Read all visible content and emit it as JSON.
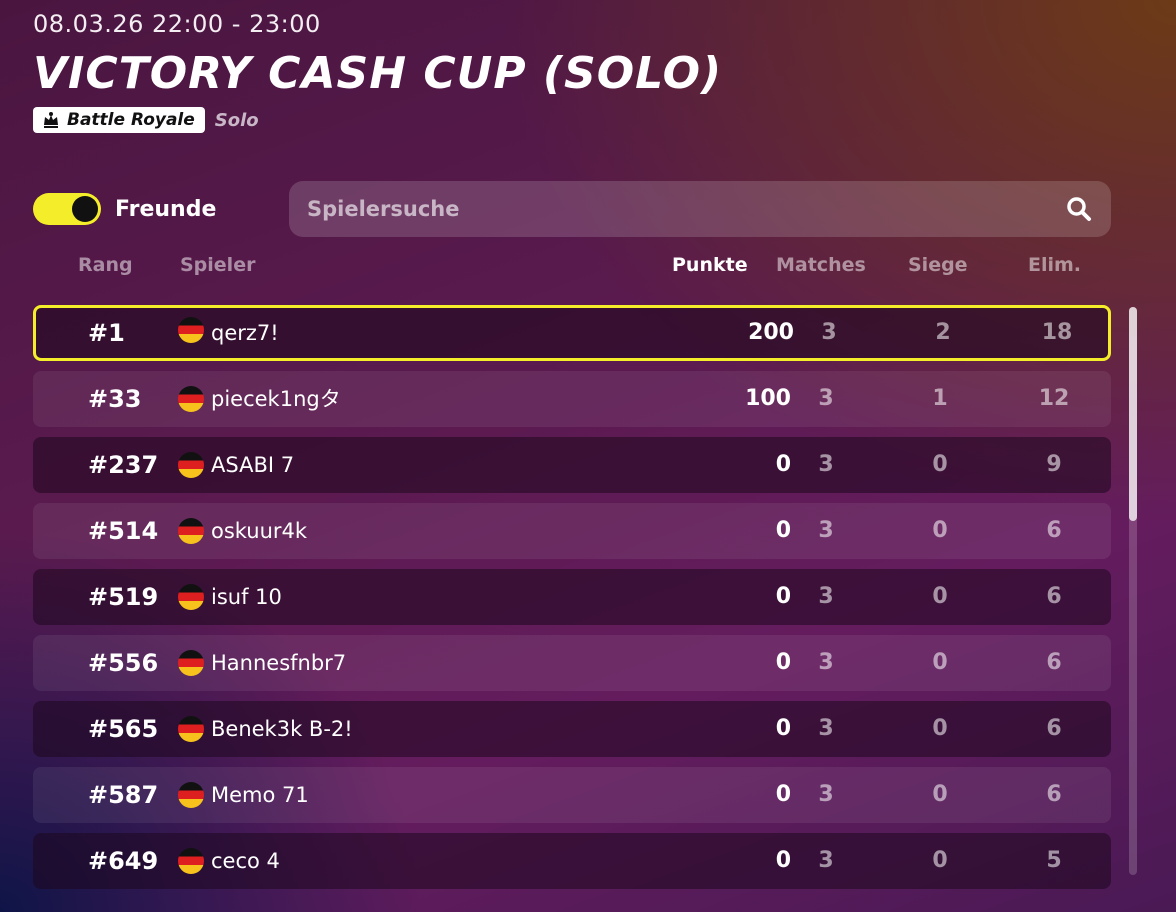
{
  "event": {
    "datetime": "08.03.26 22:00 - 23:00",
    "title": "VICTORY CASH CUP (SOLO)",
    "mode_badge": "Battle Royale",
    "type": "Solo"
  },
  "filters": {
    "friends_toggle_label": "Freunde",
    "friends_toggle_on": true,
    "search_placeholder": "Spielersuche"
  },
  "columns": {
    "rank": "Rang",
    "player": "Spieler",
    "points": "Punkte",
    "matches": "Matches",
    "wins": "Siege",
    "elims": "Elim."
  },
  "rows": [
    {
      "rank": "#1",
      "player": "qerz7!",
      "points": "200",
      "matches": "3",
      "wins": "2",
      "elims": "18"
    },
    {
      "rank": "#33",
      "player": "piecek1ngタ",
      "points": "100",
      "matches": "3",
      "wins": "1",
      "elims": "12"
    },
    {
      "rank": "#237",
      "player": "ASABI 7",
      "points": "0",
      "matches": "3",
      "wins": "0",
      "elims": "9"
    },
    {
      "rank": "#514",
      "player": "oskuur4k",
      "points": "0",
      "matches": "3",
      "wins": "0",
      "elims": "6"
    },
    {
      "rank": "#519",
      "player": "isuf 10",
      "points": "0",
      "matches": "3",
      "wins": "0",
      "elims": "6"
    },
    {
      "rank": "#556",
      "player": "Hannesfnbr7",
      "points": "0",
      "matches": "3",
      "wins": "0",
      "elims": "6"
    },
    {
      "rank": "#565",
      "player": "Benek3k B-2!",
      "points": "0",
      "matches": "3",
      "wins": "0",
      "elims": "6"
    },
    {
      "rank": "#587",
      "player": "Memo 71",
      "points": "0",
      "matches": "3",
      "wins": "0",
      "elims": "6"
    },
    {
      "rank": "#649",
      "player": "ceco 4",
      "points": "0",
      "matches": "3",
      "wins": "0",
      "elims": "5"
    }
  ],
  "colors": {
    "accent_yellow": "#f4ee2a",
    "flag": "germany-flag-icon"
  }
}
